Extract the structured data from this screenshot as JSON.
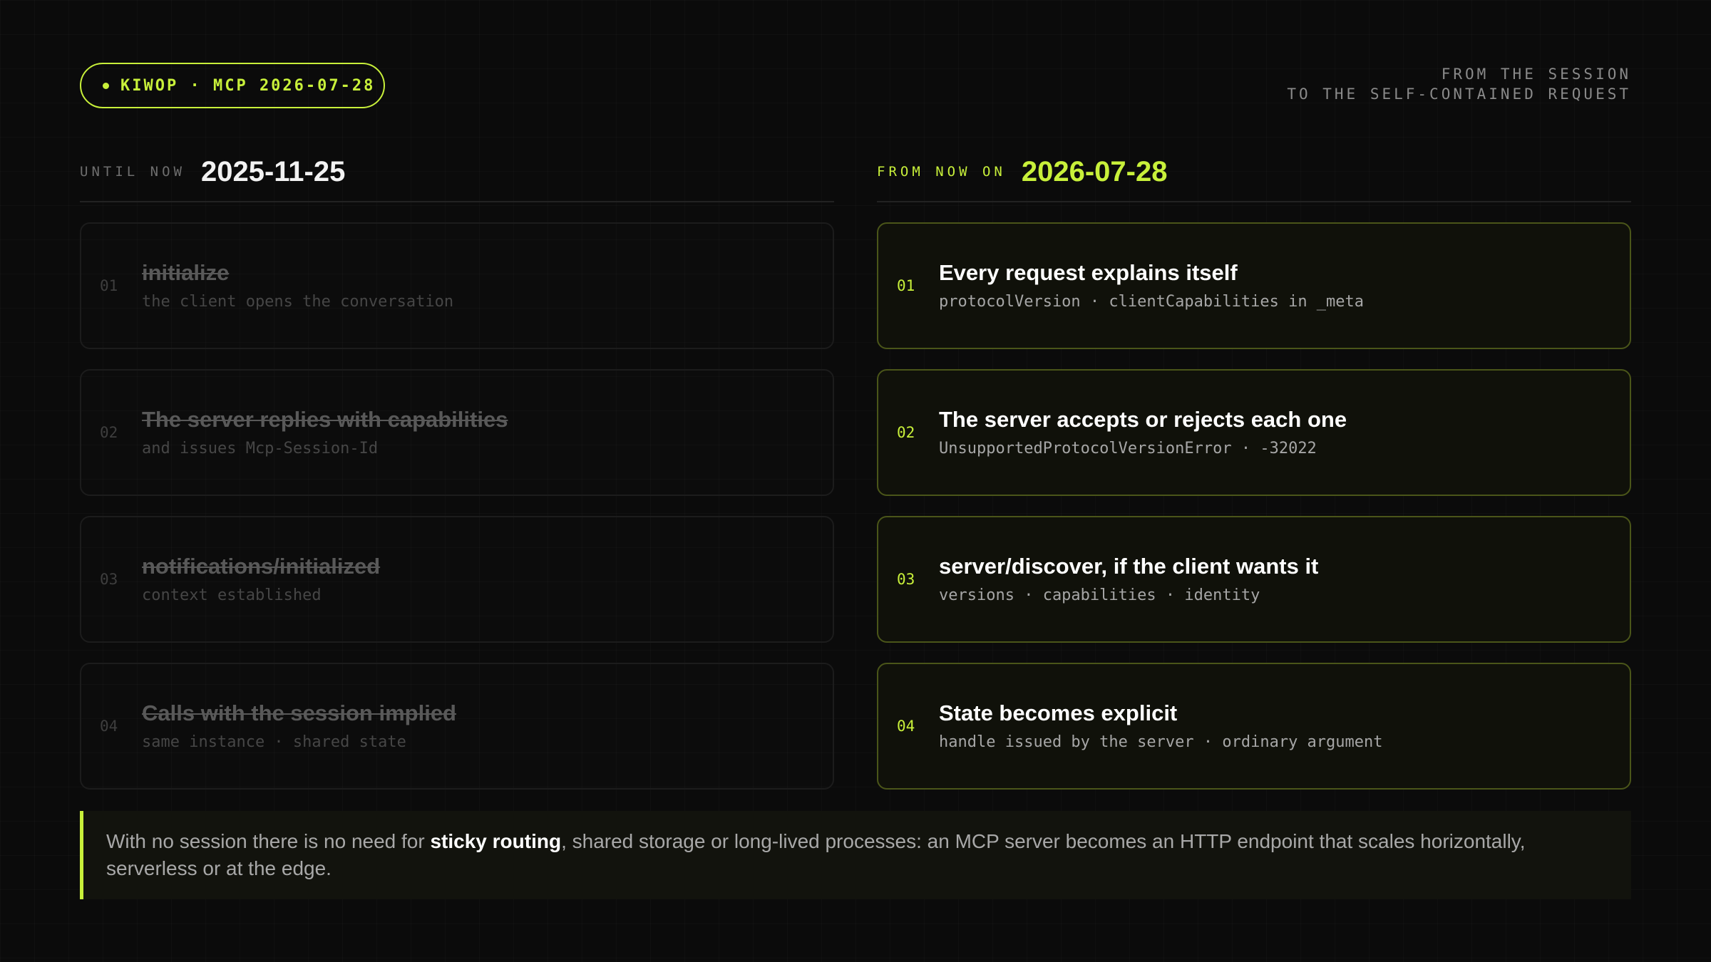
{
  "header": {
    "tag": "KIWOP · MCP 2026-07-28",
    "subtitle_line1": "FROM THE SESSION",
    "subtitle_line2": "TO THE SELF-CONTAINED REQUEST"
  },
  "left": {
    "kicker": "UNTIL NOW",
    "date": "2025-11-25",
    "cards": [
      {
        "num": "01",
        "title": "initialize",
        "detail": "the client opens the conversation"
      },
      {
        "num": "02",
        "title": "The server replies with capabilities",
        "detail": "and issues Mcp-Session-Id"
      },
      {
        "num": "03",
        "title": "notifications/initialized",
        "detail": "context established"
      },
      {
        "num": "04",
        "title": "Calls with the session implied",
        "detail": "same instance · shared state"
      }
    ]
  },
  "right": {
    "kicker": "FROM NOW ON",
    "date": "2026-07-28",
    "cards": [
      {
        "num": "01",
        "title": "Every request explains itself",
        "detail": "protocolVersion · clientCapabilities in _meta"
      },
      {
        "num": "02",
        "title": "The server accepts or rejects each one",
        "detail": "UnsupportedProtocolVersionError · -32022"
      },
      {
        "num": "03",
        "title": "server/discover, if the client wants it",
        "detail": "versions · capabilities · identity"
      },
      {
        "num": "04",
        "title": "State becomes explicit",
        "detail": "handle issued by the server · ordinary argument"
      }
    ]
  },
  "callout": {
    "before": "With no session there is no need for ",
    "emphasis": "sticky routing",
    "after": ", shared storage or long-lived processes: an MCP server becomes an HTTP endpoint that scales horizontally, serverless or at the edge."
  },
  "colors": {
    "accent": "#c8f03a",
    "background": "#0b0b0b"
  }
}
